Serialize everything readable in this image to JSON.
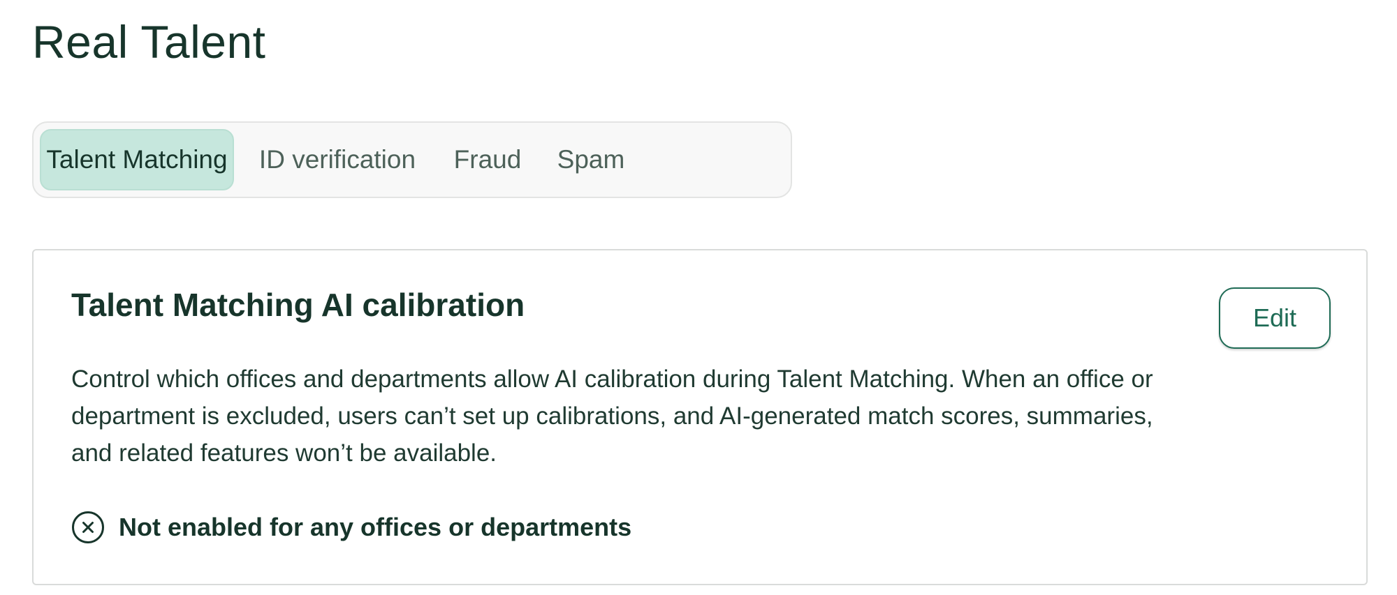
{
  "page": {
    "title": "Real Talent"
  },
  "tabs": [
    {
      "label": "Talent Matching",
      "active": true
    },
    {
      "label": "ID verification",
      "active": false
    },
    {
      "label": "Fraud",
      "active": false
    },
    {
      "label": "Spam",
      "active": false
    }
  ],
  "card": {
    "title": "Talent Matching AI calibration",
    "edit_label": "Edit",
    "description": "Control which offices and departments allow AI calibration during Talent Matching. When an office or department is excluded, users can’t set up calibrations, and AI-generated match scores, summaries, and related features won’t be available.",
    "status": {
      "icon": "circle-x-icon",
      "text": "Not enabled for any offices or departments"
    }
  },
  "colors": {
    "text_primary": "#17352b",
    "accent": "#1e6b55",
    "active_tab_bg": "#c6e7dd",
    "tab_group_bg": "#f8f8f8",
    "border": "#d9dbda"
  }
}
